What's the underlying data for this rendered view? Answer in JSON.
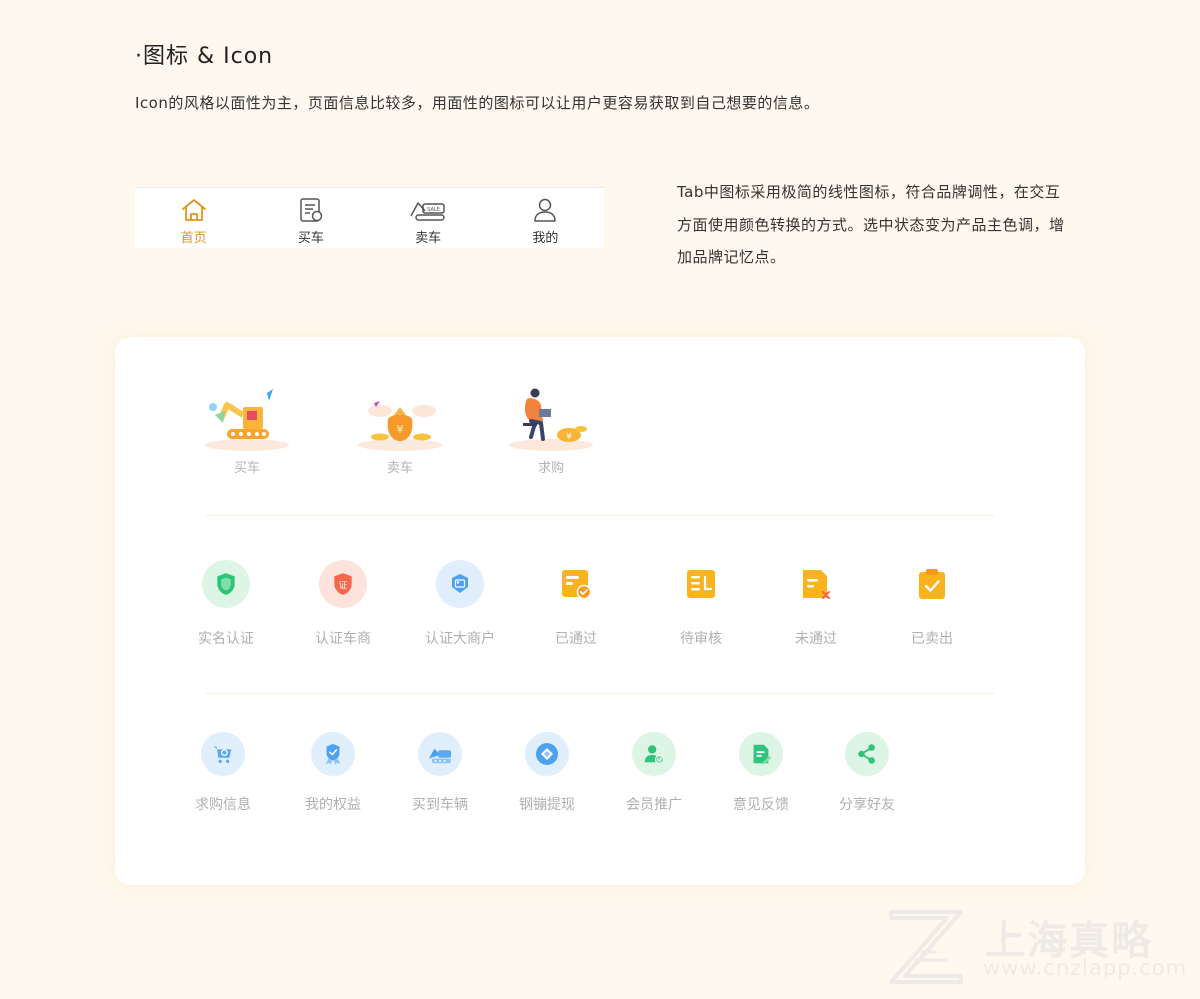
{
  "header": {
    "title": "·图标 & Icon",
    "intro": "Icon的风格以面性为主，页面信息比较多，用面性的图标可以让用户更容易获取到自己想要的信息。"
  },
  "tabbar": {
    "items": [
      {
        "label": "首页",
        "icon": "home-icon",
        "active": true
      },
      {
        "label": "买车",
        "icon": "buy-list-icon",
        "active": false
      },
      {
        "label": "卖车",
        "icon": "sale-truck-icon",
        "active": false
      },
      {
        "label": "我的",
        "icon": "user-icon",
        "active": false
      }
    ],
    "description": "Tab中图标采用极简的线性图标，符合品牌调性，在交互方面使用颜色转换的方式。选中状态变为产品主色调，增加品牌记忆点。"
  },
  "illustrations": [
    {
      "label": "买车",
      "icon": "excavator-illustration"
    },
    {
      "label": "卖车",
      "icon": "money-bag-illustration"
    },
    {
      "label": "求购",
      "icon": "person-laptop-illustration"
    }
  ],
  "status_icons": [
    {
      "label": "实名认证",
      "icon": "shield-icon"
    },
    {
      "label": "认证车商",
      "icon": "certified-badge-icon"
    },
    {
      "label": "认证大商户",
      "icon": "merchant-card-icon"
    },
    {
      "label": "已通过",
      "icon": "approved-doc-icon"
    },
    {
      "label": "待审核",
      "icon": "pending-doc-icon"
    },
    {
      "label": "未通过",
      "icon": "rejected-doc-icon"
    },
    {
      "label": "已卖出",
      "icon": "sold-clipboard-icon"
    }
  ],
  "feature_icons": [
    {
      "label": "求购信息",
      "icon": "cart-search-icon"
    },
    {
      "label": "我的权益",
      "icon": "ribbon-badge-icon"
    },
    {
      "label": "买到车辆",
      "icon": "vehicle-icon"
    },
    {
      "label": "钢镚提现",
      "icon": "coin-diamond-icon"
    },
    {
      "label": "会员推广",
      "icon": "member-promote-icon"
    },
    {
      "label": "意见反馈",
      "icon": "feedback-edit-icon"
    },
    {
      "label": "分享好友",
      "icon": "share-icon"
    }
  ],
  "watermark": {
    "brand": "上海真略",
    "url": "www.cnzlapp.com"
  },
  "colors": {
    "background": "#fff8ee",
    "accent": "#e3931b",
    "muted_label": "#b0b0b0"
  }
}
